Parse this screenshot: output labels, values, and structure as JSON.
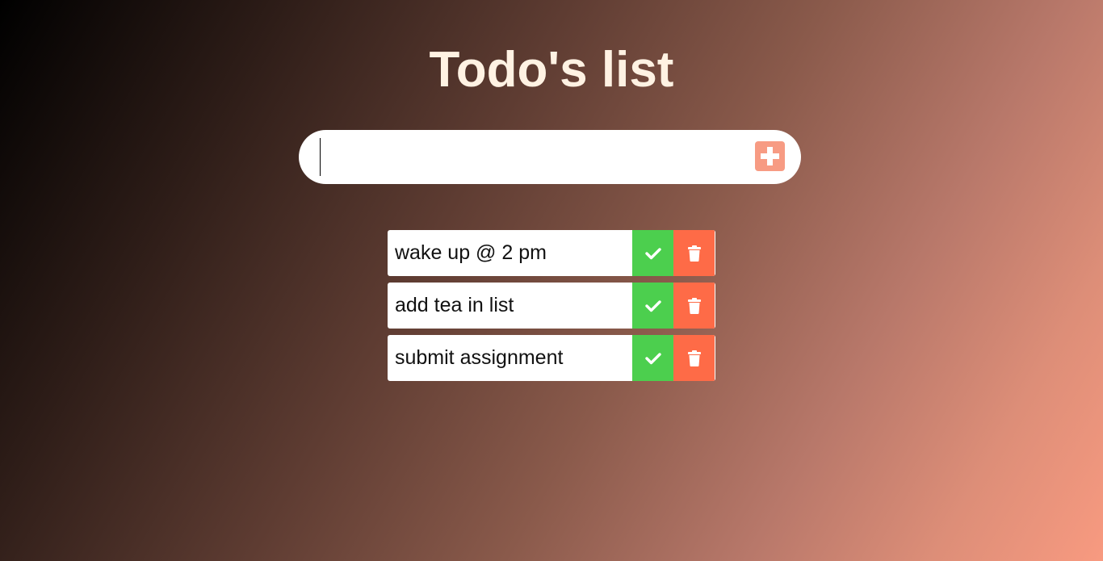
{
  "header": {
    "title": "Todo's list"
  },
  "input": {
    "value": "",
    "placeholder": ""
  },
  "add_button": {
    "icon": "plus-square-icon",
    "color": "#f79b83"
  },
  "todos": [
    {
      "text": "wake up @ 2 pm"
    },
    {
      "text": "add tea in list"
    },
    {
      "text": "submit assignment"
    }
  ],
  "colors": {
    "title": "#fff2e3",
    "complete": "#4ccf4e",
    "delete": "#fe6b47",
    "gradient_start": "#000000",
    "gradient_end": "#f89a80"
  },
  "icons": {
    "complete": "check-icon",
    "delete": "trash-icon"
  }
}
